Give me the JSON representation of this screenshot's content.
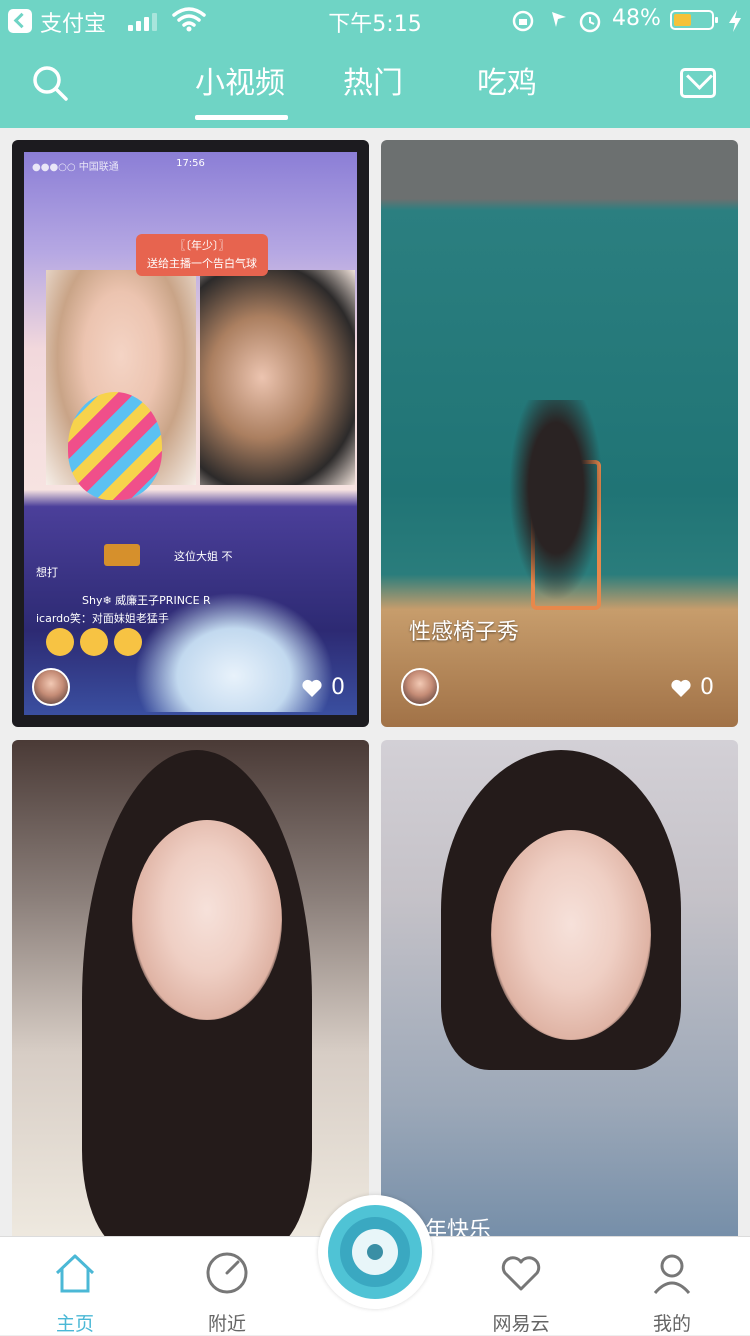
{
  "status_bar": {
    "app_name": "支付宝",
    "time": "下午5:15",
    "battery_percent": "48%",
    "battery_level": 0.48,
    "signal_bars": 3
  },
  "nav": {
    "tabs": [
      {
        "label": "小视频",
        "active": true
      },
      {
        "label": "热门",
        "active": false
      },
      {
        "label": "吃鸡",
        "active": false
      }
    ],
    "icons": {
      "left": "search-icon",
      "right": "mail-icon"
    }
  },
  "feed": [
    {
      "title": "",
      "likes": "0",
      "inner": {
        "carrier": "●●●○○ 中国联通",
        "time": "17:56",
        "gift_banner_line1": "〖〔年少〕〗",
        "gift_banner_line2": "送给主播一个告白气球",
        "chat": [
          "这位大姐 不",
          "想打",
          "Shy❄ 威廉王子PRINCE R",
          "icardo笑：对面妹姐老猛手"
        ]
      }
    },
    {
      "title": "性感椅子秀",
      "likes": "0"
    },
    {
      "title": "",
      "likes": ""
    },
    {
      "title": "",
      "overlay_text": "年快乐",
      "likes": ""
    }
  ],
  "tabbar": {
    "items": [
      {
        "label": "主页",
        "icon": "home-icon",
        "active": true
      },
      {
        "label": "附近",
        "icon": "compass-icon",
        "active": false
      },
      {
        "label": "网易云",
        "icon": "heart-icon",
        "active": false
      },
      {
        "label": "我的",
        "icon": "profile-icon",
        "active": false
      }
    ],
    "center_icon": "record-icon"
  },
  "colors": {
    "accent": "#6fd4c5",
    "tab_active": "#4bb8d6",
    "tab_inactive": "#666666"
  }
}
